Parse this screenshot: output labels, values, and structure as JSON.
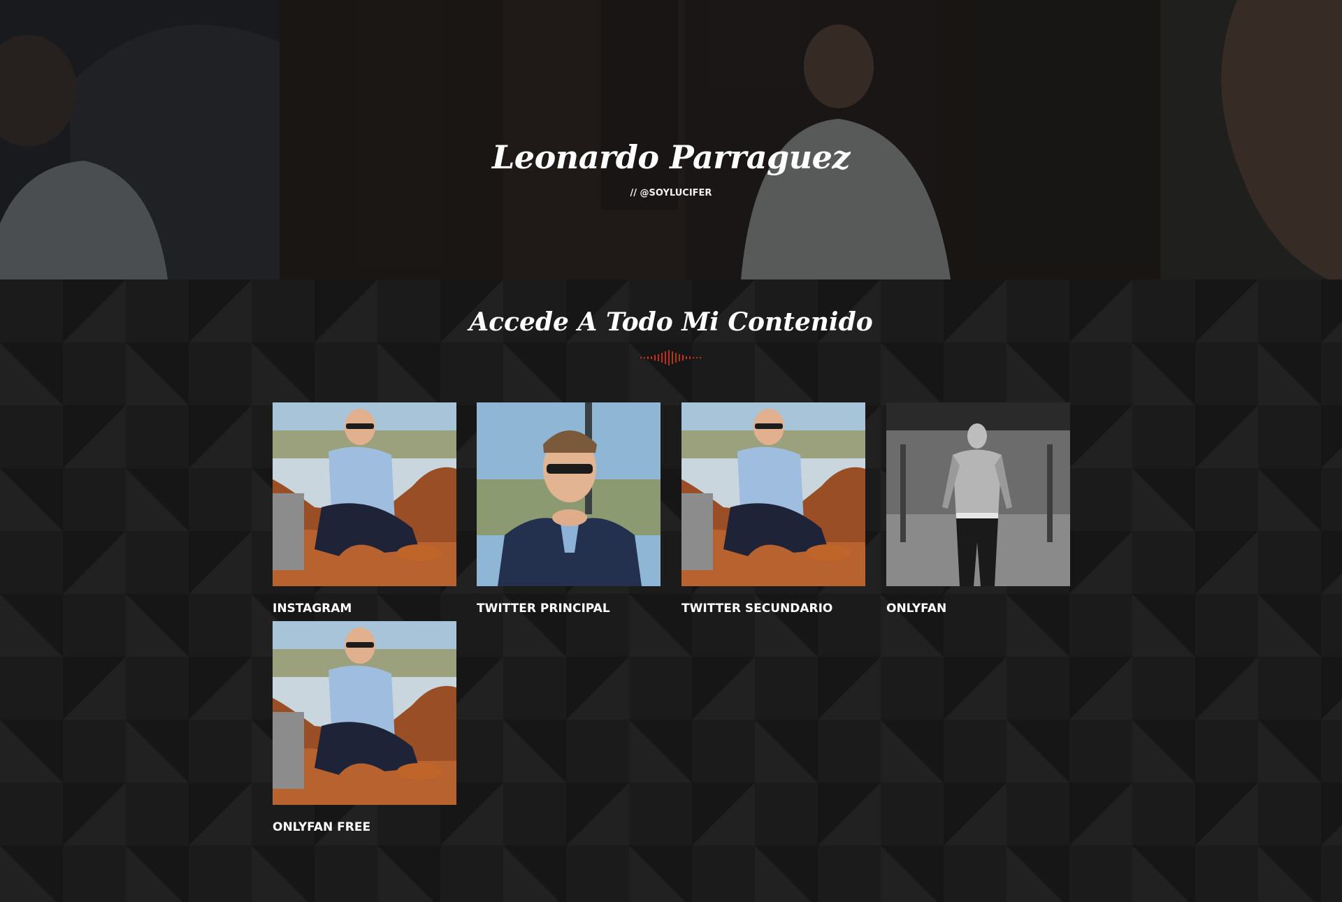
{
  "hero": {
    "title": "Leonardo Parraguez",
    "subtitle": "// @SOYLUCIFER"
  },
  "section": {
    "title": "Accede A Todo Mi Contenido"
  },
  "colors": {
    "accent": "#c0321d",
    "background": "#1b1b1b"
  },
  "links": [
    {
      "label": "INSTAGRAM",
      "image": "man-on-leather-sofa-photo"
    },
    {
      "label": "TWITTER PRINCIPAL",
      "image": "man-in-blazer-portrait-photo"
    },
    {
      "label": "TWITTER SECUNDARIO",
      "image": "man-on-leather-sofa-photo"
    },
    {
      "label": "ONLYFAN",
      "image": "shirtless-man-parking-garage-photo"
    },
    {
      "label": "ONLYFAN FREE",
      "image": "man-on-leather-sofa-photo"
    }
  ]
}
